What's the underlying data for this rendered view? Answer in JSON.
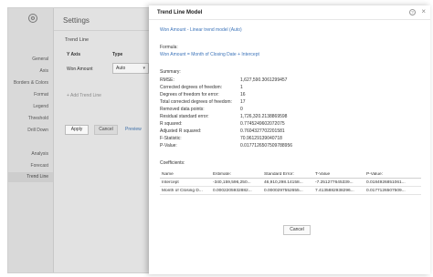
{
  "settings": {
    "title": "Settings",
    "nav": [
      "General",
      "Axis",
      "Borders & Colors",
      "Format",
      "Legend",
      "Threshold",
      "Drill Down",
      "Analysis",
      "Forecast",
      "Trend Line"
    ],
    "active_item": "Trend Line",
    "section": "Trend Line",
    "col_y_axis": "Y Axis",
    "col_type": "Type",
    "row_y_axis": "Won Amount",
    "row_type": "Auto",
    "add_trend": "+ Add Trend Line",
    "apply": "Apply",
    "cancel": "Cancel",
    "preview": "Preview"
  },
  "modal": {
    "title": "Trend Line Model",
    "model_link": "Won Amount - Linear trend model (Auto)",
    "formula_label": "Formula:",
    "formula": "Won Amount = Month of Closing Date + Intercept",
    "summary_label": "Summary:",
    "summary": [
      {
        "label": "RMSE:",
        "value": "1,627,590.3061299457"
      },
      {
        "label": "Corrected degrees of freedom:",
        "value": "1"
      },
      {
        "label": "Degrees of freedom for error:",
        "value": "16"
      },
      {
        "label": "Total corrected degrees of freedom:",
        "value": "17"
      },
      {
        "label": "Removed data points:",
        "value": "0"
      },
      {
        "label": "Residual standard error:",
        "value": "1,726,320.2138869598"
      },
      {
        "label": "R squared:",
        "value": "0.7745249602072075"
      },
      {
        "label": "Adjusted R squared:",
        "value": "0.7604327702201581"
      },
      {
        "label": "F-Statistic:",
        "value": "70.96129139040718"
      },
      {
        "label": "P-Value:",
        "value": "0.0177126507509788956"
      }
    ],
    "coefficients_label": "Coefficients:",
    "coef_headers": [
      "Name",
      "Estimate:",
      "Standard Error:",
      "T-Value",
      "P-Value:"
    ],
    "coef_rows": [
      [
        "Intercept",
        "-340,159,596,250...",
        "46,910,298.14158...",
        "-7.251277645339...",
        "0.0184926851061..."
      ],
      [
        "Month of Closing D...",
        "0.0002205932882...",
        "0.0000297552655...",
        "7.4135882938296...",
        "0.0177126507509..."
      ]
    ],
    "cancel": "Cancel"
  }
}
